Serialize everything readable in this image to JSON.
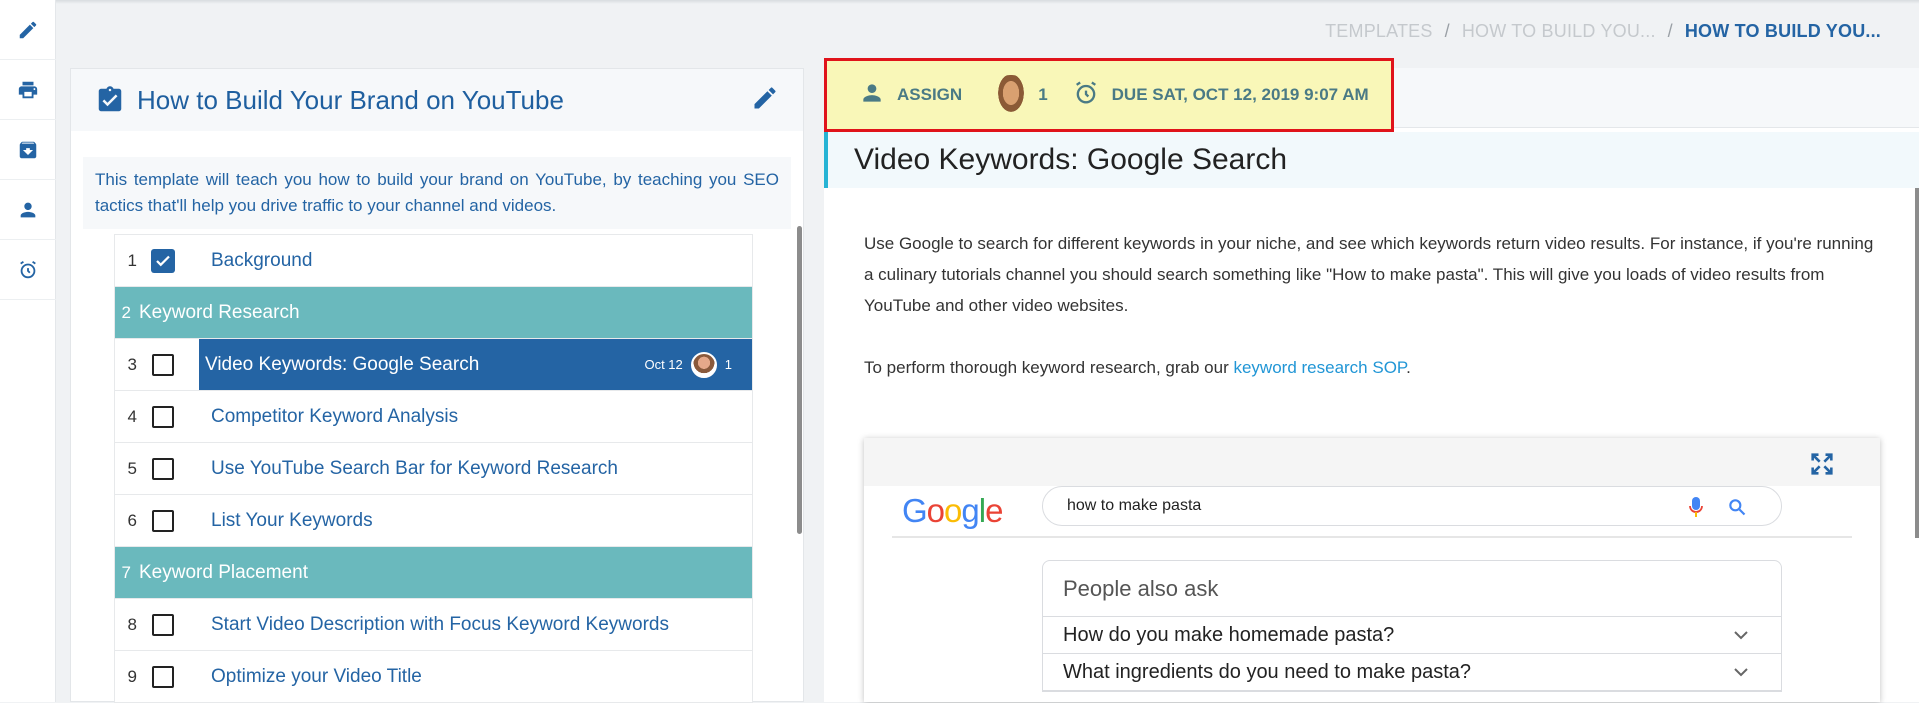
{
  "rail": {
    "items": [
      {
        "name": "edit",
        "icon": "pencil-icon"
      },
      {
        "name": "print",
        "icon": "print-icon"
      },
      {
        "name": "archive",
        "icon": "archive-icon"
      },
      {
        "name": "users",
        "icon": "person-icon"
      },
      {
        "name": "reminders",
        "icon": "alarm-icon"
      }
    ]
  },
  "breadcrumb": {
    "items": [
      "TEMPLATES",
      "HOW TO BUILD YOU...",
      "HOW TO BUILD YOU..."
    ],
    "separator": "/"
  },
  "template": {
    "title": "How to Build Your Brand on YouTube",
    "description": "This template will teach you how to build your brand on YouTube, by teaching you SEO tactics that'll help you drive traffic to your channel and videos."
  },
  "tasks": [
    {
      "num": "1",
      "label": "Background",
      "type": "task",
      "checked": true
    },
    {
      "num": "2",
      "label": "Keyword Research",
      "type": "heading"
    },
    {
      "num": "3",
      "label": "Video Keywords: Google Search",
      "type": "task",
      "checked": false,
      "active": true,
      "due": "Oct 12",
      "assignees": "1"
    },
    {
      "num": "4",
      "label": "Competitor Keyword Analysis",
      "type": "task",
      "checked": false
    },
    {
      "num": "5",
      "label": "Use YouTube Search Bar for Keyword Research",
      "type": "task",
      "checked": false
    },
    {
      "num": "6",
      "label": "List Your Keywords",
      "type": "task",
      "checked": false
    },
    {
      "num": "7",
      "label": "Keyword Placement",
      "type": "heading"
    },
    {
      "num": "8",
      "label": "Start Video Description with Focus Keyword Keywords",
      "type": "task",
      "checked": false
    },
    {
      "num": "9",
      "label": "Optimize your Video Title",
      "type": "task",
      "checked": false
    }
  ],
  "task_detail": {
    "assign_label": "ASSIGN",
    "assignee_count": "1",
    "due_label": "DUE SAT, OCT 12, 2019 9:07 AM",
    "title": "Video Keywords: Google Search",
    "paragraph1": "Use Google to search for different keywords in your niche, and see which keywords return video results. For instance, if you're running a culinary tutorials channel you should search something like \"How to make pasta\". This will give you loads of video results from YouTube and other video websites.",
    "paragraph2_prefix": "To perform thorough keyword research, grab our ",
    "paragraph2_link": "keyword research SOP",
    "paragraph2_suffix": "."
  },
  "embedded_image": {
    "logo_letters": [
      "G",
      "o",
      "o",
      "g",
      "l",
      "e"
    ],
    "search_query": "how to make pasta",
    "paa_title": "People also ask",
    "paa_items": [
      "How do you make homemade pasta?",
      "What ingredients do you need to make pasta?"
    ]
  },
  "colors": {
    "primary": "#2464a4",
    "heading_row": "#6ab9bd",
    "highlight_fill": "#f9f7b8",
    "highlight_border": "#e0131a",
    "link": "#2196d6"
  }
}
